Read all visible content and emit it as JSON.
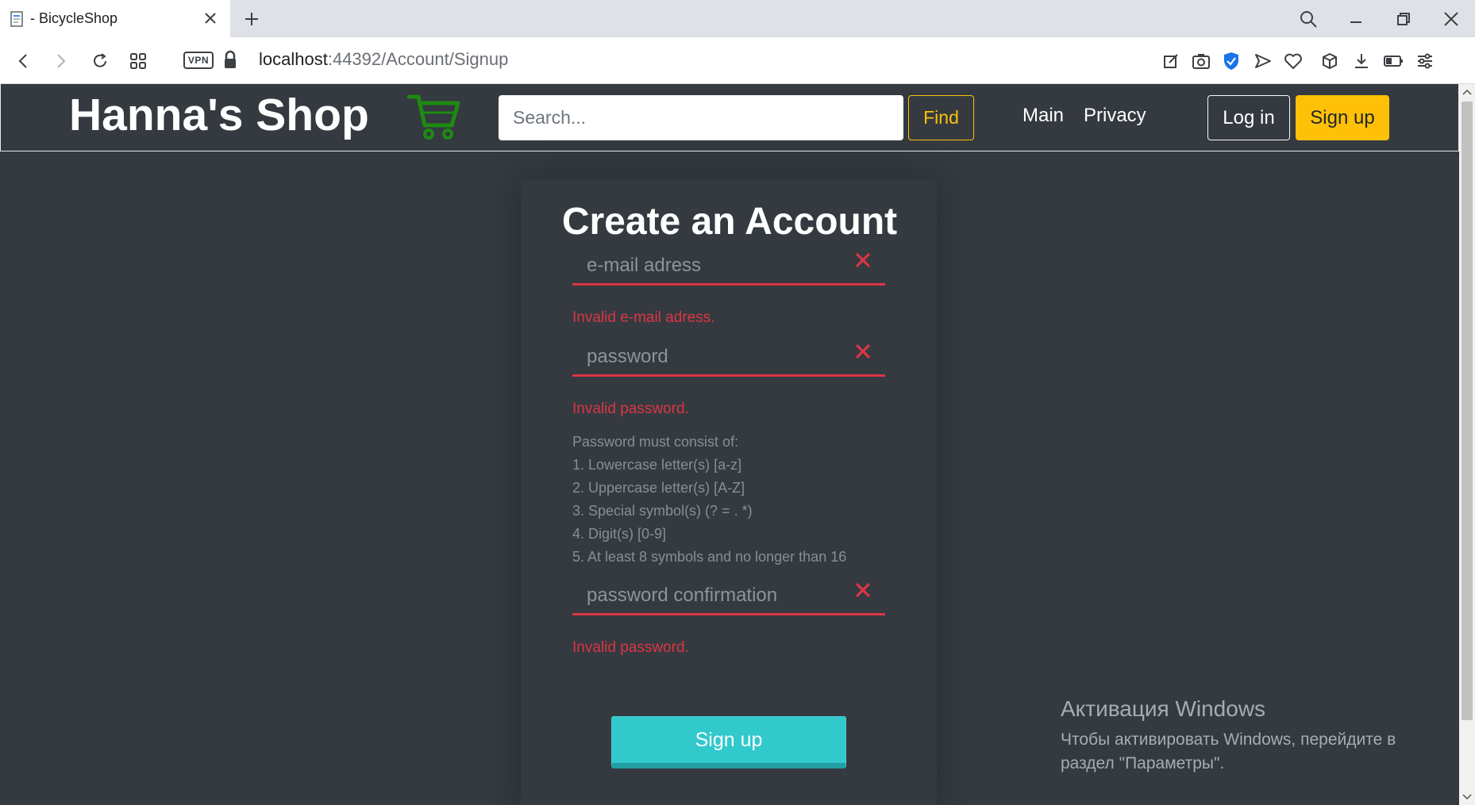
{
  "browser": {
    "tab_title": "- BicycleShop",
    "vpn_label": "VPN",
    "url_host": "localhost",
    "url_path": ":44392/Account/Signup"
  },
  "navbar": {
    "brand": "Hanna's Shop",
    "search_placeholder": "Search...",
    "find_label": "Find",
    "links": [
      "Main",
      "Privacy"
    ],
    "login_label": "Log in",
    "signup_label": "Sign up",
    "cart_color": "#1e8a12"
  },
  "form": {
    "title": "Create an Account",
    "email_placeholder": "e-mail adress",
    "email_error": "Invalid e-mail adress.",
    "password_placeholder": "password",
    "password_error": "Invalid password.",
    "password_rules": [
      "Password must consist of:",
      "1. Lowercase letter(s) [a-z]",
      "2. Uppercase letter(s) [A-Z]",
      "3. Special symbol(s) (? = . *)",
      "4. Digit(s) [0-9]",
      "5. At least 8 symbols and no longer than 16"
    ],
    "confirm_placeholder": "password confirmation",
    "confirm_error": "Invalid password.",
    "submit_label": "Sign up",
    "error_color": "#dc3545",
    "submit_color": "#31c9cc"
  },
  "watermark": {
    "title": "Активация Windows",
    "line1": "Чтобы активировать Windows, перейдите в",
    "line2": "раздел \"Параметры\"."
  }
}
